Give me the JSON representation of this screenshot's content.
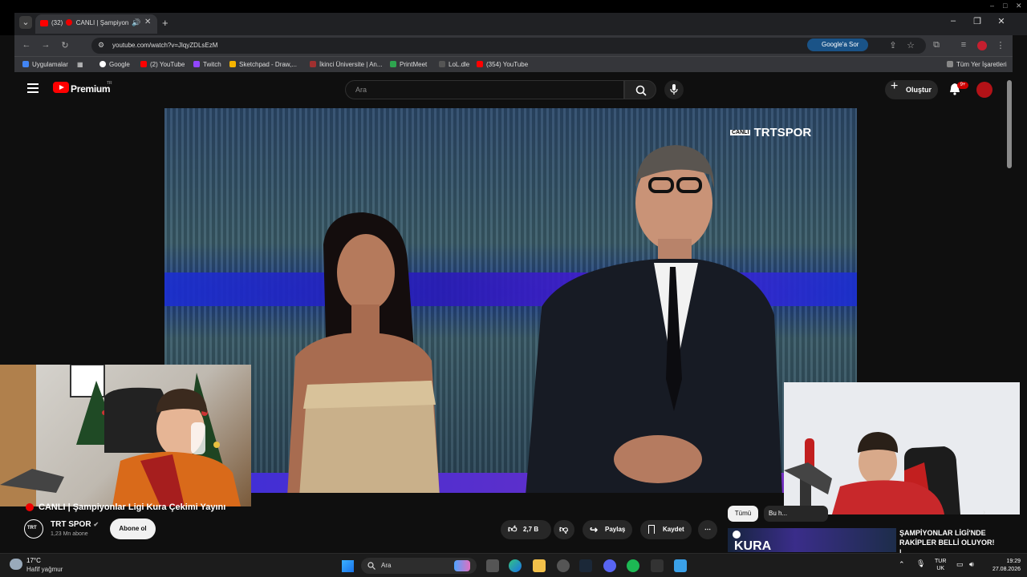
{
  "browser": {
    "tab_count_label": "(32)",
    "active_tab_title": "CANLI | Şampiyon...",
    "url": "youtube.com/watch?v=JlqyZDLsEzM",
    "google_sor": "Google'a Sor",
    "bookmarks": [
      "Uygulamalar",
      "Google",
      "(2) YouTube",
      "Twitch",
      "Sketchpad - Draw,...",
      "İkinci Üniversite | An...",
      "PrintMeet",
      "LoL.dle",
      "(354) YouTube"
    ],
    "all_bookmarks": "Tüm Yer İşaretleri"
  },
  "youtube": {
    "logo_text": "Premium",
    "logo_region": "TR",
    "search_placeholder": "Ara",
    "create_label": "Oluştur",
    "notif_badge": "9+"
  },
  "video": {
    "channel_bug_prefix": "CANLI",
    "channel_bug": "TRTSPOR",
    "title": "CANLI | Şampiyonlar Ligi Kura Çekimi Yayını",
    "channel_name": "TRT SPOR",
    "subscribers": "1,23 Mn abone",
    "subscribe_label": "Abone ol",
    "likes": "2,7 B",
    "share_label": "Paylaş",
    "save_label": "Kaydet"
  },
  "recommendations": {
    "chip_all": "Tümü",
    "chip_second": "Bu h...",
    "thumb_text": "KURA",
    "title": "ŞAMPİYONLAR LİGİ'NDE RAKİPLER BELLİ OLUYOR! |"
  },
  "taskbar": {
    "temperature": "17°C",
    "weather": "Hafif yağmur",
    "search_label": "Ara",
    "lang_top": "TUR",
    "lang_bottom": "UK",
    "time": "19:29",
    "date": "27.08.2026"
  }
}
